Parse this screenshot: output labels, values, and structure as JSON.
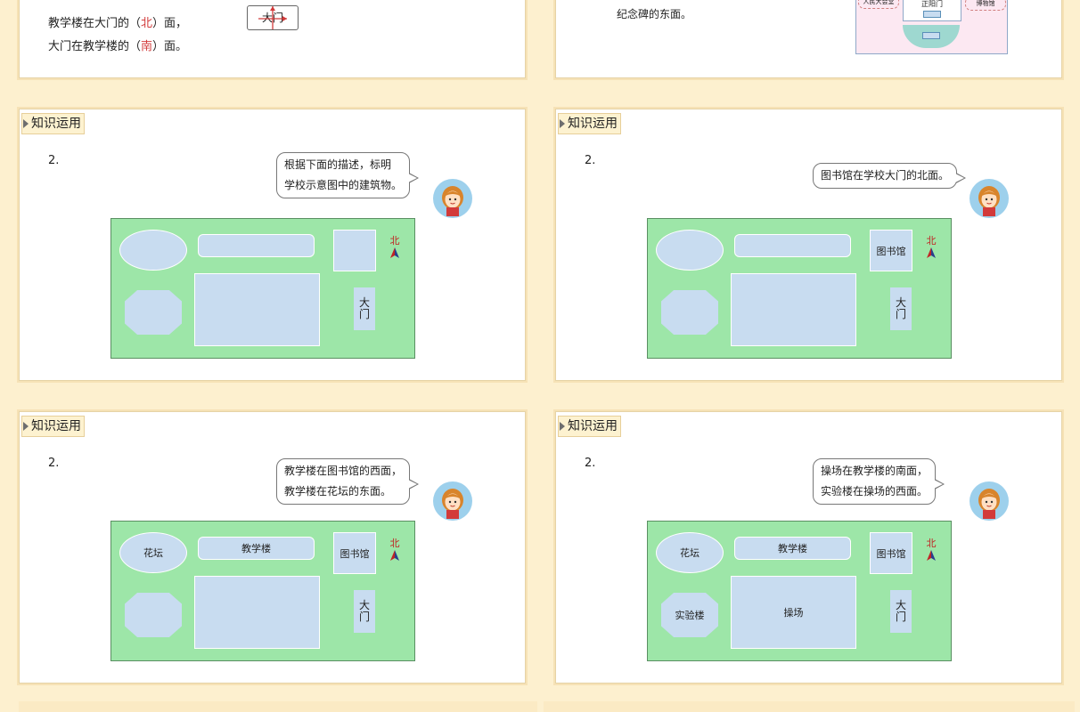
{
  "section_tag": "知识运用",
  "item_number": "2.",
  "map_labels": {
    "library": "图书馆",
    "gate_1": "大",
    "gate_2": "门",
    "flower_bed": "花坛",
    "teaching_building": "教学楼",
    "lab_building": "实验楼",
    "playground": "操场",
    "north": "北"
  },
  "top_left": {
    "line1_pre": "教学楼在大门的（",
    "line1_answer": "北",
    "line1_post": "）面，",
    "line2_pre": "大门在教学楼的（",
    "line2_answer": "南",
    "line2_post": "）面。",
    "box_label": "大门"
  },
  "top_right": {
    "text": "纪念碑的东面。",
    "left_label": "人民大会堂",
    "center_label": "正阳门",
    "right_label": "博物馆"
  },
  "slides": {
    "s1": {
      "bubble_line1": "根据下面的描述，标明",
      "bubble_line2": "学校示意图中的建筑物。"
    },
    "s2": {
      "bubble_line1": "图书馆在学校大门的北面。"
    },
    "s3": {
      "bubble_line1": "教学楼在图书馆的西面，",
      "bubble_line2": "教学楼在花坛的东面。"
    },
    "s4": {
      "bubble_line1": "操场在教学楼的南面，",
      "bubble_line2": "实验楼在操场的西面。"
    }
  },
  "colors": {
    "map_green": "#9de6a8",
    "building_blue": "#c8dcf0",
    "answer_red": "#d23a3a",
    "page_bg": "#fdf0cf"
  }
}
